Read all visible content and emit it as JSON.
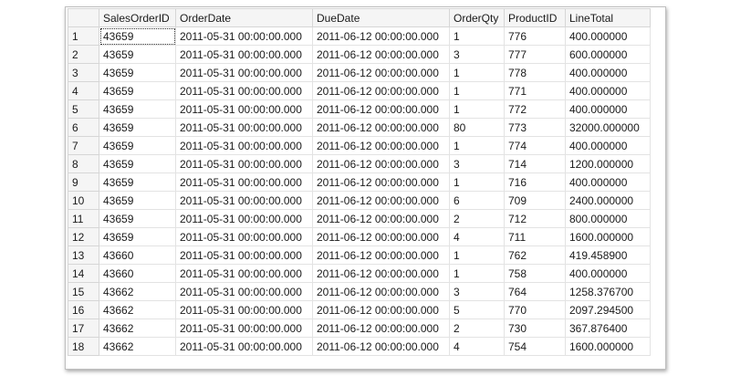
{
  "grid": {
    "columns": [
      "",
      "SalesOrderID",
      "OrderDate",
      "DueDate",
      "OrderQty",
      "ProductID",
      "LineTotal"
    ],
    "rows": [
      [
        "1",
        "43659",
        "2011-05-31 00:00:00.000",
        "2011-06-12 00:00:00.000",
        "1",
        "776",
        "400.000000"
      ],
      [
        "2",
        "43659",
        "2011-05-31 00:00:00.000",
        "2011-06-12 00:00:00.000",
        "3",
        "777",
        "600.000000"
      ],
      [
        "3",
        "43659",
        "2011-05-31 00:00:00.000",
        "2011-06-12 00:00:00.000",
        "1",
        "778",
        "400.000000"
      ],
      [
        "4",
        "43659",
        "2011-05-31 00:00:00.000",
        "2011-06-12 00:00:00.000",
        "1",
        "771",
        "400.000000"
      ],
      [
        "5",
        "43659",
        "2011-05-31 00:00:00.000",
        "2011-06-12 00:00:00.000",
        "1",
        "772",
        "400.000000"
      ],
      [
        "6",
        "43659",
        "2011-05-31 00:00:00.000",
        "2011-06-12 00:00:00.000",
        "80",
        "773",
        "32000.000000"
      ],
      [
        "7",
        "43659",
        "2011-05-31 00:00:00.000",
        "2011-06-12 00:00:00.000",
        "1",
        "774",
        "400.000000"
      ],
      [
        "8",
        "43659",
        "2011-05-31 00:00:00.000",
        "2011-06-12 00:00:00.000",
        "3",
        "714",
        "1200.000000"
      ],
      [
        "9",
        "43659",
        "2011-05-31 00:00:00.000",
        "2011-06-12 00:00:00.000",
        "1",
        "716",
        "400.000000"
      ],
      [
        "10",
        "43659",
        "2011-05-31 00:00:00.000",
        "2011-06-12 00:00:00.000",
        "6",
        "709",
        "2400.000000"
      ],
      [
        "11",
        "43659",
        "2011-05-31 00:00:00.000",
        "2011-06-12 00:00:00.000",
        "2",
        "712",
        "800.000000"
      ],
      [
        "12",
        "43659",
        "2011-05-31 00:00:00.000",
        "2011-06-12 00:00:00.000",
        "4",
        "711",
        "1600.000000"
      ],
      [
        "13",
        "43660",
        "2011-05-31 00:00:00.000",
        "2011-06-12 00:00:00.000",
        "1",
        "762",
        "419.458900"
      ],
      [
        "14",
        "43660",
        "2011-05-31 00:00:00.000",
        "2011-06-12 00:00:00.000",
        "1",
        "758",
        "400.000000"
      ],
      [
        "15",
        "43662",
        "2011-05-31 00:00:00.000",
        "2011-06-12 00:00:00.000",
        "3",
        "764",
        "1258.376700"
      ],
      [
        "16",
        "43662",
        "2011-05-31 00:00:00.000",
        "2011-06-12 00:00:00.000",
        "5",
        "770",
        "2097.294500"
      ],
      [
        "17",
        "43662",
        "2011-05-31 00:00:00.000",
        "2011-06-12 00:00:00.000",
        "2",
        "730",
        "367.876400"
      ],
      [
        "18",
        "43662",
        "2011-05-31 00:00:00.000",
        "2011-06-12 00:00:00.000",
        "4",
        "754",
        "1600.000000"
      ]
    ]
  }
}
